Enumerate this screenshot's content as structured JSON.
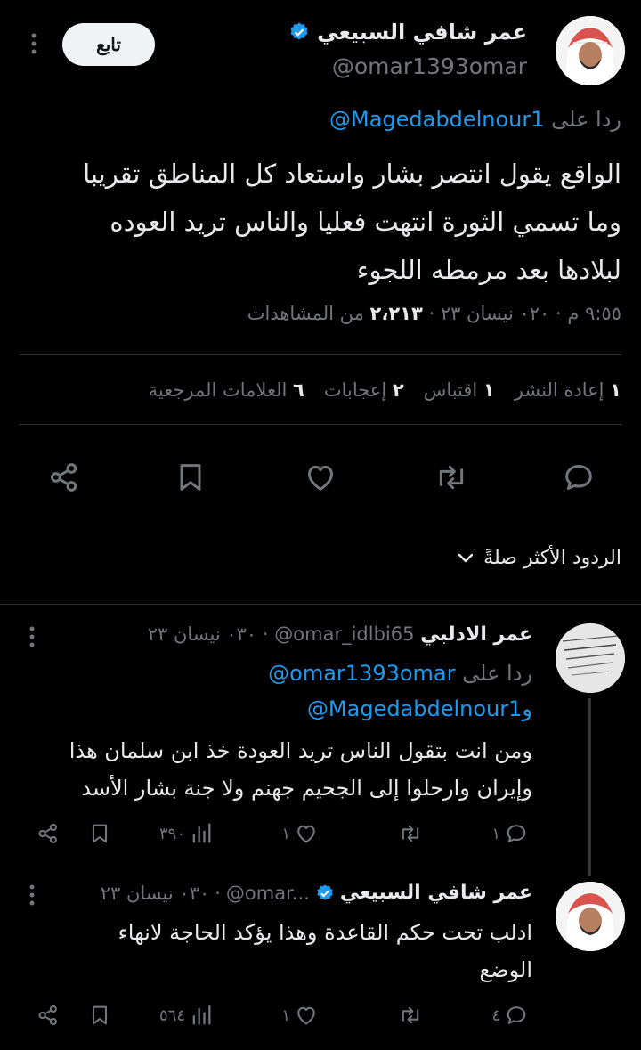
{
  "main_tweet": {
    "author_name": "عمر شافي السبيعي",
    "handle": "@omar1393omar",
    "follow_label": "تابع",
    "replying_prefix": "ردا على",
    "replying_to": "@Magedabdelnour1",
    "text_lines": [
      "الواقع يقول انتصر بشار واستعاد كل المناطق تقريبا",
      "وما تسمي الثورة انتهت  فعليا  والناس تريد العوده",
      "لبلادها بعد مرمطه اللجوء"
    ],
    "time": "٩:٥٥ م",
    "date": "٠٢٠ نيسان ٢٣",
    "views_count": "٢،٢١٣",
    "views_label": "من المشاهدات",
    "stats": {
      "retweets_count": "١",
      "retweets_label": "إعادة النشر",
      "quotes_count": "١",
      "quotes_label": "اقتباس",
      "likes_count": "٢",
      "likes_label": "إعجابات",
      "bookmarks_count": "٦",
      "bookmarks_label": "العلامات المرجعية"
    }
  },
  "sort": {
    "label": "الردود الأكثر صلةً"
  },
  "replies": [
    {
      "author_name": "عمر الادلبي",
      "handle": "@omar_idlbi65",
      "date": "٠٣٠ نيسان ٢٣",
      "replying_prefix": "ردا على",
      "replying_to_1": "@omar1393omar",
      "replying_and": "و",
      "replying_to_2": "@Magedabdelnour1",
      "text_lines": [
        "ومن انت بتقول الناس تريد العودة خذ ابن سلمان هذا",
        "وإيران وارحلوا إلى الجحيم جهنم ولا جنة بشار الأسد"
      ],
      "replies_count": "١",
      "retweets_count": "",
      "likes_count": "١",
      "views_count": "٣٩٠"
    },
    {
      "author_name": "عمر شافي السبيعي",
      "handle": "@omar...",
      "date": "٠٣٠ نيسان ٢٣",
      "text_lines": [
        "ادلب تحت  حكم القاعدة  وهذا يؤكد الحاجة  لانهاء",
        "الوضع"
      ],
      "replies_count": "٤",
      "retweets_count": "",
      "likes_count": "١",
      "views_count": "٥٦٤"
    }
  ],
  "colors": {
    "background": "#000000",
    "text": "#e7e9ea",
    "muted": "#71767b",
    "link": "#1d9bf0",
    "divider": "#2f3336",
    "verified": "#1d9bf0"
  }
}
